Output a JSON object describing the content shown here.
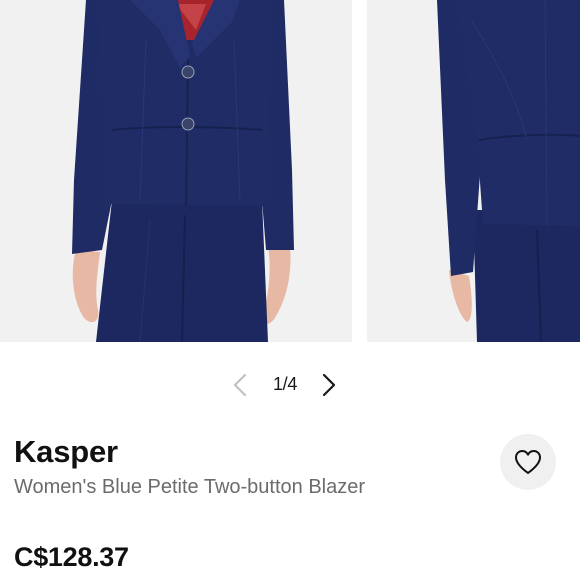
{
  "gallery": {
    "photos": [
      {
        "icon": "blazer-front-photo"
      },
      {
        "icon": "blazer-back-photo"
      }
    ],
    "pager": {
      "count_label": "1/4",
      "prev_icon": "chevron-left-icon",
      "next_icon": "chevron-right-icon"
    }
  },
  "product": {
    "brand": "Kasper",
    "title": "Women's Blue Petite Two-button Blazer",
    "price": "C$128.37",
    "like_icon": "heart-outline-icon"
  },
  "colors": {
    "navy": "#1d2a63",
    "photo_bg": "#f1f1f1",
    "text_primary": "#111111",
    "text_secondary": "#6b6b6b",
    "like_bg": "#f0f0f0"
  }
}
